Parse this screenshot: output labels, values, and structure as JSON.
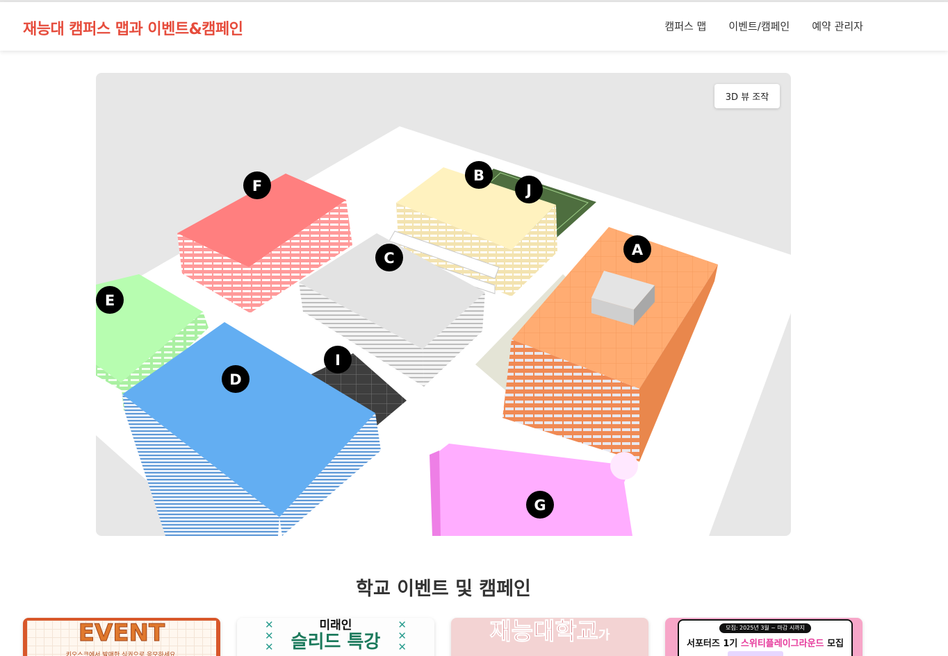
{
  "app": {
    "title": "재능대 캠퍼스 맵과 이벤트&캠페인"
  },
  "nav": {
    "items": [
      {
        "label": "캠퍼스 맵"
      },
      {
        "label": "이벤트/캠페인"
      },
      {
        "label": "예약 관리자"
      }
    ]
  },
  "map": {
    "view_button": "3D 뷰 조작",
    "buildings": [
      {
        "label": "A",
        "color": "#ffaa6f"
      },
      {
        "label": "B",
        "color": "#fff2bf"
      },
      {
        "label": "C",
        "color": "#e3e3e3"
      },
      {
        "label": "D",
        "color": "#63aef2"
      },
      {
        "label": "E",
        "color": "#b7fdb0"
      },
      {
        "label": "F",
        "color": "#ff7f7f"
      },
      {
        "label": "G",
        "color": "#ffadff"
      },
      {
        "label": "I",
        "color": "#3f3f3f"
      },
      {
        "label": "J",
        "color": "#4e6e3f"
      }
    ]
  },
  "events": {
    "section_title": "학교 이벤트 및 캠페인",
    "cards": [
      {
        "headline": "EVENT",
        "subtext": "키오스크에서 발매한 식권으로 응모하세요."
      },
      {
        "headline": "미래인",
        "subtext": "슬리드 특강"
      },
      {
        "headline": "재능대학교",
        "subtext": "가"
      },
      {
        "badge": "모집: 2025년 3월 ~ 마감 시까지",
        "headline_prefix": "서포터즈 1기",
        "headline_highlight": "스위티플레이그라운드",
        "headline_suffix": "모집"
      }
    ]
  }
}
